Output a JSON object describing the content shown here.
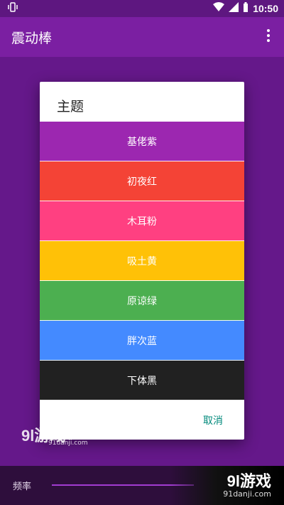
{
  "status_bar": {
    "time": "10:50"
  },
  "app_bar": {
    "title": "震动棒"
  },
  "dialog": {
    "title": "主题",
    "options": [
      {
        "label": "基佬紫",
        "color": "#9c27b0"
      },
      {
        "label": "初夜红",
        "color": "#f44336"
      },
      {
        "label": "木耳粉",
        "color": "#ff4081"
      },
      {
        "label": "吸土黄",
        "color": "#ffc107"
      },
      {
        "label": "原谅绿",
        "color": "#4caf50"
      },
      {
        "label": "胖次蓝",
        "color": "#448aff"
      },
      {
        "label": "下体黑",
        "color": "#212121"
      }
    ],
    "cancel_label": "取消"
  },
  "bottom": {
    "frequency_label": "频率"
  },
  "watermark": {
    "logo": "9l游戏",
    "url": "91danji.com"
  }
}
